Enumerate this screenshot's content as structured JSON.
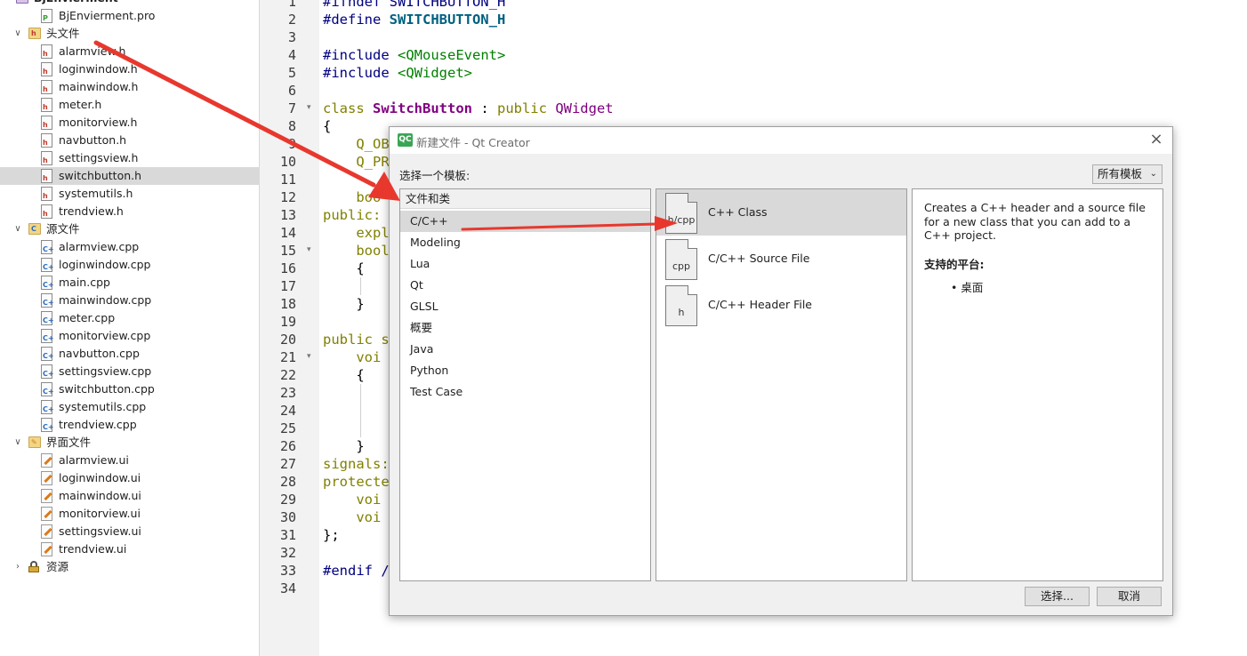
{
  "project_tree": {
    "project_name": "BjEnvierment",
    "items": [
      {
        "label": "BjEnvierment.pro",
        "type": "pro",
        "level": 1
      },
      {
        "label": "头文件",
        "type": "folder",
        "folder_glyph": "h",
        "expanded": true,
        "level": 0
      },
      {
        "label": "alarmview.h",
        "type": "h",
        "level": 1
      },
      {
        "label": "loginwindow.h",
        "type": "h",
        "level": 1
      },
      {
        "label": "mainwindow.h",
        "type": "h",
        "level": 1
      },
      {
        "label": "meter.h",
        "type": "h",
        "level": 1
      },
      {
        "label": "monitorview.h",
        "type": "h",
        "level": 1
      },
      {
        "label": "navbutton.h",
        "type": "h",
        "level": 1
      },
      {
        "label": "settingsview.h",
        "type": "h",
        "level": 1
      },
      {
        "label": "switchbutton.h",
        "type": "h",
        "level": 1,
        "selected": true
      },
      {
        "label": "systemutils.h",
        "type": "h",
        "level": 1
      },
      {
        "label": "trendview.h",
        "type": "h",
        "level": 1
      },
      {
        "label": "源文件",
        "type": "folder",
        "folder_glyph": "C",
        "expanded": true,
        "level": 0
      },
      {
        "label": "alarmview.cpp",
        "type": "cpp",
        "level": 1
      },
      {
        "label": "loginwindow.cpp",
        "type": "cpp",
        "level": 1
      },
      {
        "label": "main.cpp",
        "type": "cpp",
        "level": 1
      },
      {
        "label": "mainwindow.cpp",
        "type": "cpp",
        "level": 1
      },
      {
        "label": "meter.cpp",
        "type": "cpp",
        "level": 1
      },
      {
        "label": "monitorview.cpp",
        "type": "cpp",
        "level": 1
      },
      {
        "label": "navbutton.cpp",
        "type": "cpp",
        "level": 1
      },
      {
        "label": "settingsview.cpp",
        "type": "cpp",
        "level": 1
      },
      {
        "label": "switchbutton.cpp",
        "type": "cpp",
        "level": 1
      },
      {
        "label": "systemutils.cpp",
        "type": "cpp",
        "level": 1
      },
      {
        "label": "trendview.cpp",
        "type": "cpp",
        "level": 1
      },
      {
        "label": "界面文件",
        "type": "folder",
        "folder_glyph": "ui",
        "expanded": true,
        "level": 0
      },
      {
        "label": "alarmview.ui",
        "type": "ui",
        "level": 1
      },
      {
        "label": "loginwindow.ui",
        "type": "ui",
        "level": 1
      },
      {
        "label": "mainwindow.ui",
        "type": "ui",
        "level": 1
      },
      {
        "label": "monitorview.ui",
        "type": "ui",
        "level": 1
      },
      {
        "label": "settingsview.ui",
        "type": "ui",
        "level": 1
      },
      {
        "label": "trendview.ui",
        "type": "ui",
        "level": 1
      },
      {
        "label": "资源",
        "type": "resource",
        "expanded": false,
        "level": 0
      }
    ]
  },
  "editor": {
    "line_numbers": [
      "1",
      "2",
      "3",
      "4",
      "5",
      "6",
      "7",
      "8",
      "9",
      "10",
      "11",
      "12",
      "13",
      "14",
      "15",
      "16",
      "17",
      "18",
      "19",
      "20",
      "21",
      "22",
      "23",
      "24",
      "25",
      "26",
      "27",
      "28",
      "29",
      "30",
      "31",
      "32",
      "33",
      "34"
    ],
    "fold_markers_on_lines": [
      7,
      15,
      21
    ],
    "lines": [
      [
        {
          "t": "#ifndef ",
          "c": "mac"
        },
        {
          "t": "SWITCHBUTTON_H",
          "c": "mac"
        }
      ],
      [
        {
          "t": "#define ",
          "c": "mac"
        },
        {
          "t": "SWITCHBUTTON_H",
          "c": "mbold"
        }
      ],
      [],
      [
        {
          "t": "#include ",
          "c": "mac"
        },
        {
          "t": "<QMouseEvent>",
          "c": "str"
        }
      ],
      [
        {
          "t": "#include ",
          "c": "mac"
        },
        {
          "t": "<QWidget>",
          "c": "str"
        }
      ],
      [],
      [
        {
          "t": "class ",
          "c": "kw"
        },
        {
          "t": "SwitchButton",
          "c": "cls"
        },
        {
          "t": " : ",
          "c": "plain"
        },
        {
          "t": "public ",
          "c": "kw"
        },
        {
          "t": "QWidget",
          "c": "typ"
        }
      ],
      [
        {
          "t": "{",
          "c": "plain"
        }
      ],
      [
        {
          "t": "    Q_OB",
          "c": "kw"
        }
      ],
      [
        {
          "t": "    Q_PR",
          "c": "kw"
        }
      ],
      [],
      [
        {
          "t": "    boo",
          "c": "kw"
        }
      ],
      [
        {
          "t": "public:",
          "c": "kw"
        }
      ],
      [
        {
          "t": "    expl",
          "c": "kw"
        }
      ],
      [
        {
          "t": "    bool",
          "c": "kw"
        }
      ],
      [
        {
          "t": "    {",
          "c": "plain"
        }
      ],
      [],
      [
        {
          "t": "    }",
          "c": "plain"
        }
      ],
      [],
      [
        {
          "t": "public s",
          "c": "kw"
        }
      ],
      [
        {
          "t": "    voi",
          "c": "kw"
        }
      ],
      [
        {
          "t": "    {",
          "c": "plain"
        }
      ],
      [],
      [],
      [],
      [
        {
          "t": "    }",
          "c": "plain"
        }
      ],
      [
        {
          "t": "signals:",
          "c": "kw"
        }
      ],
      [
        {
          "t": "protecte",
          "c": "kw"
        }
      ],
      [
        {
          "t": "    voi",
          "c": "kw"
        }
      ],
      [
        {
          "t": "    voi",
          "c": "kw"
        }
      ],
      [
        {
          "t": "};",
          "c": "plain"
        }
      ],
      [],
      [
        {
          "t": "#endif /",
          "c": "mac"
        }
      ],
      []
    ]
  },
  "dialog": {
    "logo_text": "QC",
    "title": "新建文件 - Qt Creator",
    "close_icon": "×",
    "choose_template_label": "选择一个模板:",
    "template_filter": "所有模板",
    "category_header": "文件和类",
    "categories": [
      "C/C++",
      "Modeling",
      "Lua",
      "Qt",
      "GLSL",
      "概要",
      "Java",
      "Python",
      "Test Case"
    ],
    "selected_category": "C/C++",
    "templates": [
      {
        "label": "C++ Class",
        "icon_ext": "h/cpp",
        "selected": true
      },
      {
        "label": "C/C++ Source File",
        "icon_ext": "cpp",
        "selected": false
      },
      {
        "label": "C/C++ Header File",
        "icon_ext": "h",
        "selected": false
      }
    ],
    "description": "Creates a C++ header and a source file for a new class that you can add to a C++ project.",
    "platforms_label": "支持的平台:",
    "platforms": [
      "• 桌面"
    ],
    "choose_button": "选择...",
    "cancel_button": "取消"
  },
  "annotations": {
    "arrow_color": "#e8382e"
  }
}
